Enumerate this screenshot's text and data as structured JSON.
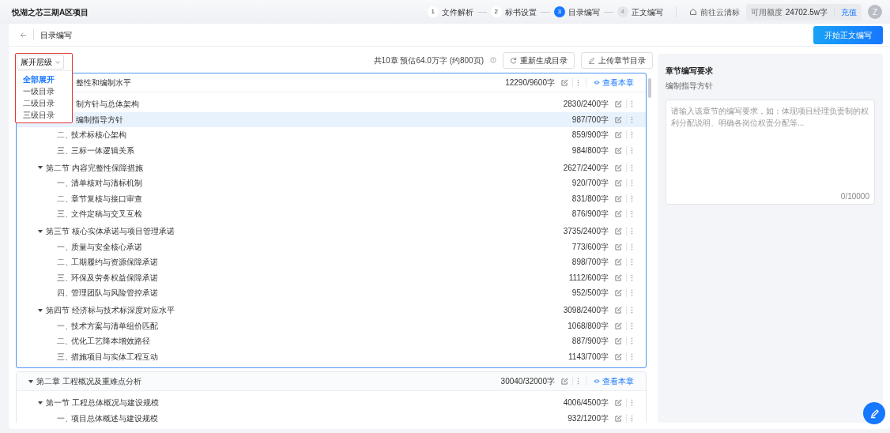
{
  "header": {
    "project_title": "悦湖之芯三期A区项目",
    "steps": [
      {
        "number": "1",
        "label": "文件解析",
        "selected": false,
        "disabled": false
      },
      {
        "number": "2",
        "label": "标书设置",
        "selected": false,
        "disabled": false
      },
      {
        "number": "3",
        "label": "目录编写",
        "selected": true,
        "disabled": false
      },
      {
        "number": "4",
        "label": "正文编写",
        "selected": false,
        "disabled": true
      }
    ],
    "cloud_link": "前往云清标",
    "quota_label": "可用额度",
    "quota_value": "24702.5w字",
    "recharge": "充值",
    "avatar": "Z"
  },
  "page": {
    "title": "目录编写",
    "primary_button": "开始正文编写"
  },
  "toolbar": {
    "expand_button": "展开层级",
    "expand_menu": [
      {
        "label": "全部展开",
        "selected": true
      },
      {
        "label": "一级目录",
        "selected": false
      },
      {
        "label": "二级目录",
        "selected": false
      },
      {
        "label": "三级目录",
        "selected": false
      }
    ],
    "summary": "共10章 预估64.0万字 (约800页)",
    "buttons": [
      {
        "kind": "refresh",
        "label": "重新生成目录"
      },
      {
        "kind": "upload",
        "label": "上传章节目录"
      }
    ]
  },
  "chapters": [
    {
      "title": "整性和编制水平",
      "partial": true,
      "count": "12290/9600字",
      "view_link": "查看本章",
      "active": true,
      "selected": false,
      "children": [
        {
          "title": "制方针与总体架构",
          "partial": true,
          "count": "2830/2400字",
          "selected": false,
          "children": [
            {
              "title": "编制指导方针",
              "partial": true,
              "count": "987/700字",
              "selected": true
            },
            {
              "number": "二、",
              "title": "技术标核心架构",
              "count": "859/900字",
              "selected": false
            },
            {
              "number": "三、",
              "title": "三标一体逻辑关系",
              "count": "984/800字",
              "selected": false
            }
          ]
        },
        {
          "title": "第二节 内容完整性保障措施",
          "count": "2627/2400字",
          "expanded": true,
          "selected": false,
          "children": [
            {
              "number": "一、",
              "title": "清单核对与清标机制",
              "count": "920/700字",
              "selected": false
            },
            {
              "number": "二、",
              "title": "章节复核与接口审查",
              "count": "831/800字",
              "selected": false
            },
            {
              "number": "三、",
              "title": "文件定稿与交叉互检",
              "count": "876/900字",
              "selected": false
            }
          ]
        },
        {
          "title": "第三节 核心实体承诺与项目管理承诺",
          "count": "3735/2400字",
          "expanded": true,
          "selected": false,
          "children": [
            {
              "number": "一、",
              "title": "质量与安全核心承诺",
              "count": "773/600字",
              "selected": false
            },
            {
              "number": "二、",
              "title": "工期履约与资源保障承诺",
              "count": "898/700字",
              "selected": false
            },
            {
              "number": "三、",
              "title": "环保及劳务权益保障承诺",
              "count": "1112/600字",
              "selected": false
            },
            {
              "number": "四、",
              "title": "管理团队与风险管控承诺",
              "count": "952/500字",
              "selected": false
            }
          ]
        },
        {
          "title": "第四节 经济标与技术标深度对应水平",
          "count": "3098/2400字",
          "expanded": true,
          "selected": false,
          "children": [
            {
              "number": "一、",
              "title": "技术方案与清单组价匹配",
              "count": "1068/800字",
              "selected": false
            },
            {
              "number": "二、",
              "title": "优化工艺降本增效路径",
              "count": "887/900字",
              "selected": false
            },
            {
              "number": "三、",
              "title": "措施项目与实体工程互动",
              "count": "1143/700字",
              "selected": false
            }
          ]
        }
      ]
    },
    {
      "title": "第二章 工程概况及重难点分析",
      "count": "30040/32000字",
      "view_link": "查看本章",
      "active": false,
      "expanded": true,
      "selected": false,
      "children": [
        {
          "title": "第一节 工程总体概况与建设规模",
          "count": "4006/4500字",
          "expanded": true,
          "selected": false,
          "children": [
            {
              "number": "一、",
              "title": "项目总体概述与建设规模",
              "count": "932/1200字",
              "selected": false
            }
          ]
        }
      ]
    }
  ],
  "requirements": {
    "title": "章节编写要求",
    "subtitle": "编制指导方针",
    "placeholder": "请输入该章节的编写要求，如：体现项目经理负责制的权利分配说明、明确各岗位权责分配等...",
    "counter": "0/10000"
  }
}
